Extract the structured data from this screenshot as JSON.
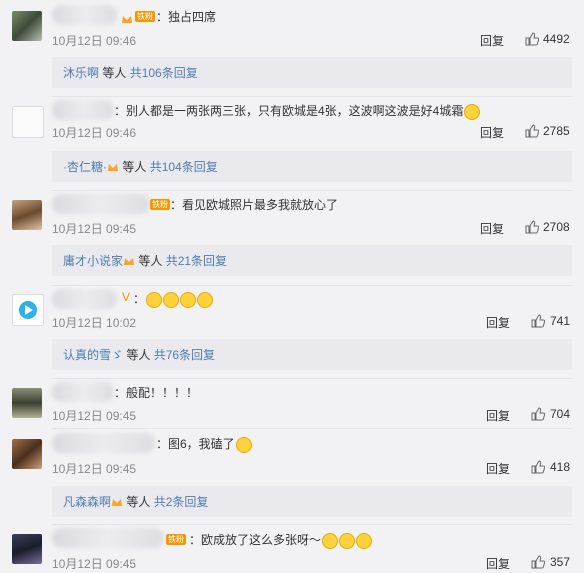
{
  "comments": [
    {
      "text": "：独占四席",
      "time": "10月12日 09:46",
      "reply": "回复",
      "likes": "4492",
      "badge": "铁粉",
      "thread": {
        "user": "沐乐啊",
        "suffix": " 等人",
        "count": "共106条回复"
      }
    },
    {
      "text": "：别人都是一两张两三张，只有欧城是4张，这波啊这波是好4城霜",
      "time": "10月12日 09:46",
      "reply": "回复",
      "likes": "2785",
      "thread": {
        "user": "·杏仁糖·",
        "suffix": " 等人",
        "count": "共104条回复"
      }
    },
    {
      "text": "：看见欧城照片最多我就放心了",
      "time": "10月12日 09:45",
      "reply": "回复",
      "likes": "2708",
      "badge": "铁粉",
      "thread": {
        "user": "庸才小说家",
        "suffix": " 等人",
        "count": "共21条回复"
      }
    },
    {
      "text": "：",
      "time": "10月12日 10:02",
      "reply": "回复",
      "likes": "741",
      "thread": {
        "user": "认真的雪ゞ",
        "suffix": " 等人",
        "count": "共76条回复"
      }
    },
    {
      "text": "：般配！！！！",
      "time": "10月12日 09:45",
      "reply": "回复",
      "likes": "704"
    },
    {
      "text": "：图6，我磕了",
      "time": "10月12日 09:45",
      "reply": "回复",
      "likes": "418",
      "thread": {
        "user": "凡森森啊",
        "suffix": " 等人",
        "count": "共2条回复"
      }
    },
    {
      "text": "：欧成放了这么多张呀～",
      "time": "10月12日 09:45",
      "reply": "回复",
      "likes": "357",
      "badge": "铁粉"
    }
  ],
  "colors": {
    "link": "#507daf",
    "badge": "#f39800",
    "background": "#f2f2f5"
  }
}
